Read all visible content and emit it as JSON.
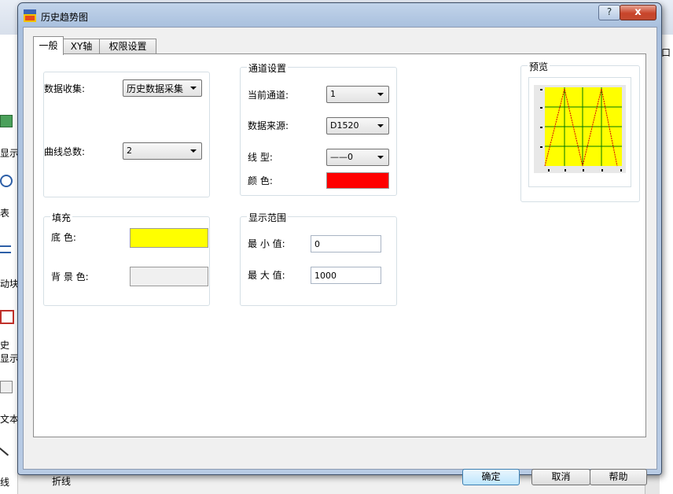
{
  "background": {
    "left_labels": [
      "显示",
      "表",
      "动块",
      "史",
      "显示",
      "文本",
      "线"
    ],
    "bottom_label": "折线",
    "right_label": "口"
  },
  "dialog": {
    "title": "历史趋势图",
    "help_label": "?",
    "close_label": "x"
  },
  "tabs": [
    {
      "label": "一般",
      "active": true
    },
    {
      "label": "XY轴",
      "active": false
    },
    {
      "label": "权限设置",
      "active": false
    }
  ],
  "general": {
    "data_collect_label": "数据收集:",
    "data_collect_value": "历史数据采集",
    "curve_count_label": "曲线总数:",
    "curve_count_value": "2"
  },
  "channel": {
    "title": "通道设置",
    "current_channel_label": "当前通道:",
    "current_channel_value": "1",
    "data_source_label": "数据来源:",
    "data_source_value": "D1520",
    "line_type_label": "线    型:",
    "line_type_value": "——0",
    "color_label": "颜    色:",
    "color_value": "#ff0000"
  },
  "fill": {
    "title": "填充",
    "bottom_color_label": "底    色:",
    "bottom_color_value": "#ffff00",
    "background_color_label": "背 景 色:",
    "background_color_value": "#f0f0f0"
  },
  "range": {
    "title": "显示范围",
    "min_label": "最 小 值:",
    "min_value": "0",
    "max_label": "最 大 值:",
    "max_value": "1000"
  },
  "preview": {
    "title": "预览",
    "plot_color": "#ffff00",
    "line_color": "#d40000",
    "grid_color": "#007a00"
  },
  "buttons": {
    "ok": "确定",
    "cancel": "取消",
    "help": "帮助"
  }
}
